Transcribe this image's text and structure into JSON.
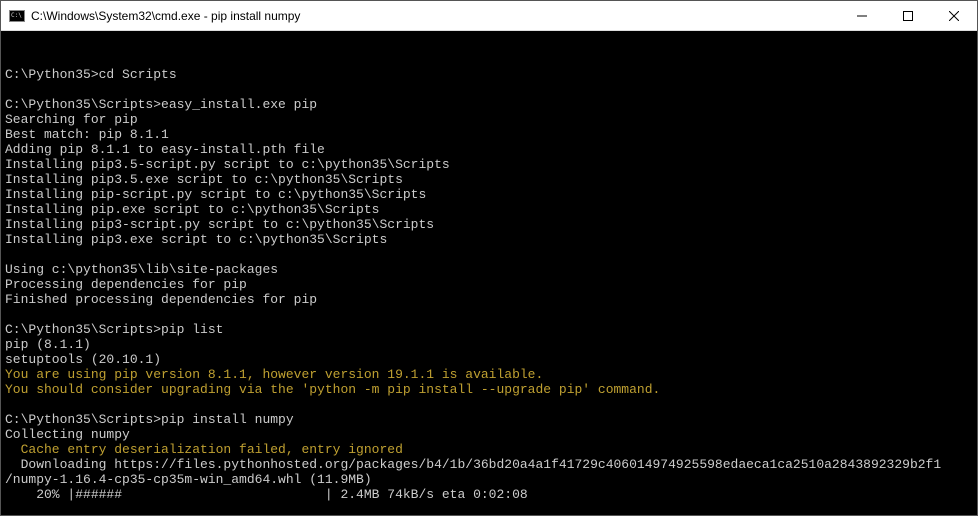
{
  "window": {
    "title": "C:\\Windows\\System32\\cmd.exe - pip  install numpy"
  },
  "lines": {
    "l0": "",
    "l1": "C:\\Python35>cd Scripts",
    "l2": "",
    "l3": "C:\\Python35\\Scripts>easy_install.exe pip",
    "l4": "Searching for pip",
    "l5": "Best match: pip 8.1.1",
    "l6": "Adding pip 8.1.1 to easy-install.pth file",
    "l7": "Installing pip3.5-script.py script to c:\\python35\\Scripts",
    "l8": "Installing pip3.5.exe script to c:\\python35\\Scripts",
    "l9": "Installing pip-script.py script to c:\\python35\\Scripts",
    "l10": "Installing pip.exe script to c:\\python35\\Scripts",
    "l11": "Installing pip3-script.py script to c:\\python35\\Scripts",
    "l12": "Installing pip3.exe script to c:\\python35\\Scripts",
    "l13": "",
    "l14": "Using c:\\python35\\lib\\site-packages",
    "l15": "Processing dependencies for pip",
    "l16": "Finished processing dependencies for pip",
    "l17": "",
    "l18": "C:\\Python35\\Scripts>pip list",
    "l19": "pip (8.1.1)",
    "l20": "setuptools (20.10.1)",
    "l21": "You are using pip version 8.1.1, however version 19.1.1 is available.",
    "l22": "You should consider upgrading via the 'python -m pip install --upgrade pip' command.",
    "l23": "",
    "l24": "C:\\Python35\\Scripts>pip install numpy",
    "l25": "Collecting numpy",
    "l26": "  Cache entry deserialization failed, entry ignored",
    "l27": "  Downloading https://files.pythonhosted.org/packages/b4/1b/36bd20a4a1f41729c406014974925598edaeca1ca2510a2843892329b2f1",
    "l28": "/numpy-1.16.4-cp35-cp35m-win_amd64.whl (11.9MB)",
    "progress": "    20% |######                          | 2.4MB 74kB/s eta 0:02:08"
  }
}
